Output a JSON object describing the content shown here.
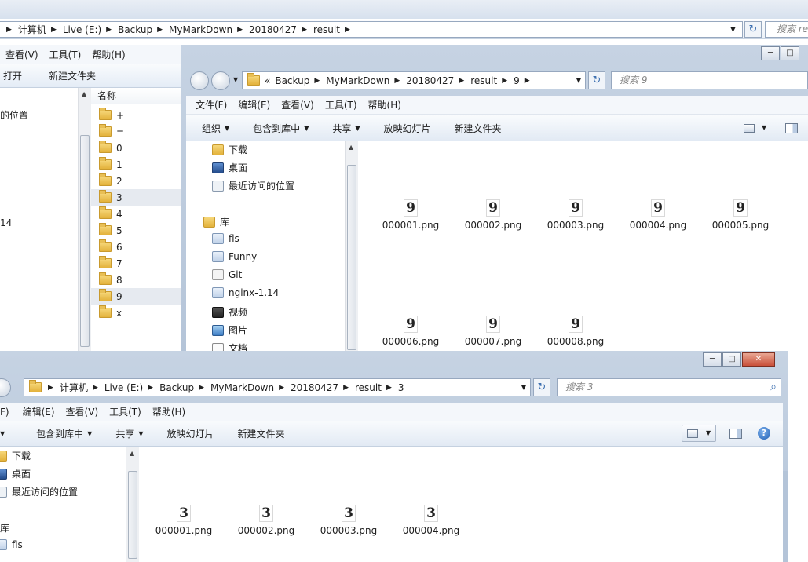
{
  "bg_window": {
    "address_crumbs": [
      "计算机",
      "Live (E:)",
      "Backup",
      "MyMarkDown",
      "20180427",
      "result"
    ],
    "search_placeholder": "搜索 re",
    "menu": [
      "查看(V)",
      "工具(T)",
      "帮助(H)"
    ],
    "cmd": [
      "打开",
      "新建文件夹"
    ],
    "nav_items": [
      "的位置",
      "14"
    ],
    "column_header": "名称",
    "folders": [
      "+",
      "=",
      "0",
      "1",
      "2",
      "3",
      "4",
      "5",
      "6",
      "7",
      "8",
      "9",
      "x"
    ],
    "selected_folders": [
      "3",
      "9"
    ]
  },
  "win9": {
    "address_prefix": "«",
    "address_crumbs": [
      "Backup",
      "MyMarkDown",
      "20180427",
      "result",
      "9"
    ],
    "search_placeholder": "搜索 9",
    "menu": [
      "文件(F)",
      "编辑(E)",
      "查看(V)",
      "工具(T)",
      "帮助(H)"
    ],
    "cmd": [
      "组织",
      "包含到库中",
      "共享",
      "放映幻灯片",
      "新建文件夹"
    ],
    "nav": {
      "downloads": "下载",
      "desktop": "桌面",
      "recent": "最近访问的位置",
      "library": "库",
      "fls": "fls",
      "funny": "Funny",
      "git": "Git",
      "nginx": "nginx-1.14",
      "video": "视频",
      "pictures": "图片",
      "docs": "文档"
    },
    "files": [
      {
        "name": "000001.png",
        "glyph": "9"
      },
      {
        "name": "000002.png",
        "glyph": "9"
      },
      {
        "name": "000003.png",
        "glyph": "9"
      },
      {
        "name": "000004.png",
        "glyph": "9"
      },
      {
        "name": "000005.png",
        "glyph": "9"
      },
      {
        "name": "000006.png",
        "glyph": "9"
      },
      {
        "name": "000007.png",
        "glyph": "9"
      },
      {
        "name": "000008.png",
        "glyph": "9"
      }
    ]
  },
  "win3": {
    "address_crumbs": [
      "计算机",
      "Live (E:)",
      "Backup",
      "MyMarkDown",
      "20180427",
      "result",
      "3"
    ],
    "search_placeholder": "搜索 3",
    "menu": [
      "F)",
      "编辑(E)",
      "查看(V)",
      "工具(T)",
      "帮助(H)"
    ],
    "cmd": [
      "包含到库中",
      "共享",
      "放映幻灯片",
      "新建文件夹"
    ],
    "nav": {
      "downloads": "下载",
      "desktop": "桌面",
      "recent": "最近访问的位置",
      "library": "库",
      "fls": "fls"
    },
    "files": [
      {
        "name": "000001.png",
        "glyph": "3"
      },
      {
        "name": "000002.png",
        "glyph": "3"
      },
      {
        "name": "000003.png",
        "glyph": "3"
      },
      {
        "name": "000004.png",
        "glyph": "3"
      }
    ]
  },
  "icons": {
    "dropdown": "▼",
    "crumb_sep": "▶",
    "refresh": "↻",
    "search": "⌕",
    "help": "?",
    "min": "─",
    "max": "□",
    "close": "✕"
  }
}
